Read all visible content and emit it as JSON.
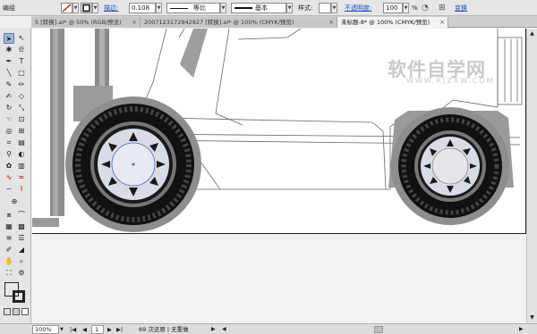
{
  "control_bar": {
    "mode_label": "编组",
    "stroke_label": "描边:",
    "stroke_value": "0.108",
    "profile_label": "等比",
    "brush_label": "基本",
    "style_label": "样式:",
    "opacity_label": "不透明度:",
    "opacity_value": "100",
    "opacity_unit": "%",
    "transform_label": "变换"
  },
  "tabs": [
    {
      "label": "5 [转换].ai* @ 50% (RGB/预览)",
      "close": "×"
    },
    {
      "label": "20071231729429​27 [转换].ai* @ 100% (CMYK/预览)",
      "close": "×"
    },
    {
      "label": "未标题-8* @ 100% (CMYK/预览)",
      "close": "×"
    }
  ],
  "watermark": {
    "title": "软件自学网",
    "subtitle": "WWW.RJZXW.COM"
  },
  "status": {
    "zoom": "100%",
    "page": "1",
    "message": "69 次还原 | 无重做"
  },
  "colors": {
    "tire": "#111111",
    "rim": "#e4e6f0",
    "fender": "#8a8a8a",
    "selection": "#4a6fd8"
  },
  "tools": [
    "selection-tool",
    "direct-selection-tool",
    "magic-wand-tool",
    "lasso-tool",
    "pen-tool",
    "type-tool",
    "line-tool",
    "rectangle-tool",
    "paintbrush-tool",
    "pencil-tool",
    "blob-brush-tool",
    "eraser-tool",
    "rotate-tool",
    "scale-tool",
    "warp-tool",
    "free-transform-tool",
    "shape-builder-tool",
    "perspective-tool",
    "mesh-tool",
    "gradient-tool",
    "eyedropper-tool",
    "blend-tool",
    "symbol-sprayer-tool",
    "graph-tool",
    "artboard-tool",
    "slice-tool",
    "hand-tool",
    "zoom-tool"
  ]
}
